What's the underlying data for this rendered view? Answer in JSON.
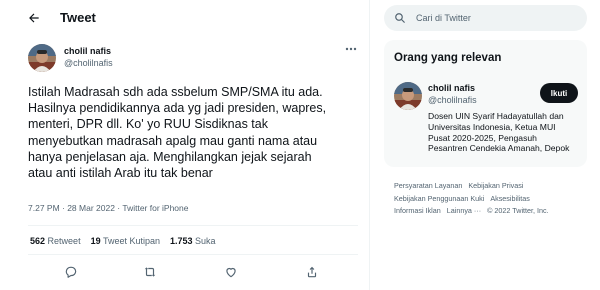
{
  "header": {
    "title": "Tweet"
  },
  "tweet": {
    "author_name": "cholil nafis",
    "author_handle": "@cholilnafis",
    "text_lines": [
      "Istilah Madrasah sdh ada ssbelum SMP/SMA itu ada.",
      "Hasilnya pendidikannya ada yg jadi presiden, wapres,",
      "menteri, DPR dll. Ko' yo RUU Sisdiknas tak",
      "menyebutkan madrasah  apalg mau ganti nama atau",
      "hanya penjelasan aja. Menghilangkan jejak sejarah",
      "atau anti istilah Arab itu tak benar"
    ],
    "time": "7.27 PM · 28 Mar 2022 · ",
    "source": "Twitter for iPhone",
    "stats": {
      "retweets_count": "562",
      "retweets_label": "Retweet",
      "quotes_count": "19",
      "quotes_label": "Tweet Kutipan",
      "likes_count": "1.753",
      "likes_label": "Suka"
    }
  },
  "search": {
    "placeholder": "Cari di Twitter"
  },
  "relevant": {
    "title": "Orang yang relevan",
    "name": "cholil nafis",
    "handle": "@cholilnafis",
    "follow_label": "Ikuti",
    "bio_lines": [
      "Dosen UIN Syarif Hadayatullah dan",
      "Universitas Indonesia, Ketua MUI",
      "Pusat 2020-2025, Pengasuh",
      "Pesantren Cendekia Amanah, Depok"
    ]
  },
  "footer": {
    "row1": [
      "Persyaratan Layanan",
      "Kebijakan Privasi"
    ],
    "row2": [
      "Kebijakan Penggunaan Kuki",
      "Aksesibilitas"
    ],
    "row3_links": [
      "Informasi Iklan",
      "Lainnya ···"
    ],
    "copyright": "© 2022 Twitter, Inc."
  },
  "colors": {
    "text_primary": "#0f1419",
    "text_secondary": "#536471",
    "divider": "#eff3f4",
    "card_bg": "#f7f9f9",
    "follow_bg": "#0f1419"
  },
  "icons": {
    "back": "arrow-left-icon",
    "more": "more-horizontal-icon",
    "reply": "reply-icon",
    "retweet": "retweet-icon",
    "like": "heart-icon",
    "share": "share-icon",
    "search": "search-icon"
  }
}
